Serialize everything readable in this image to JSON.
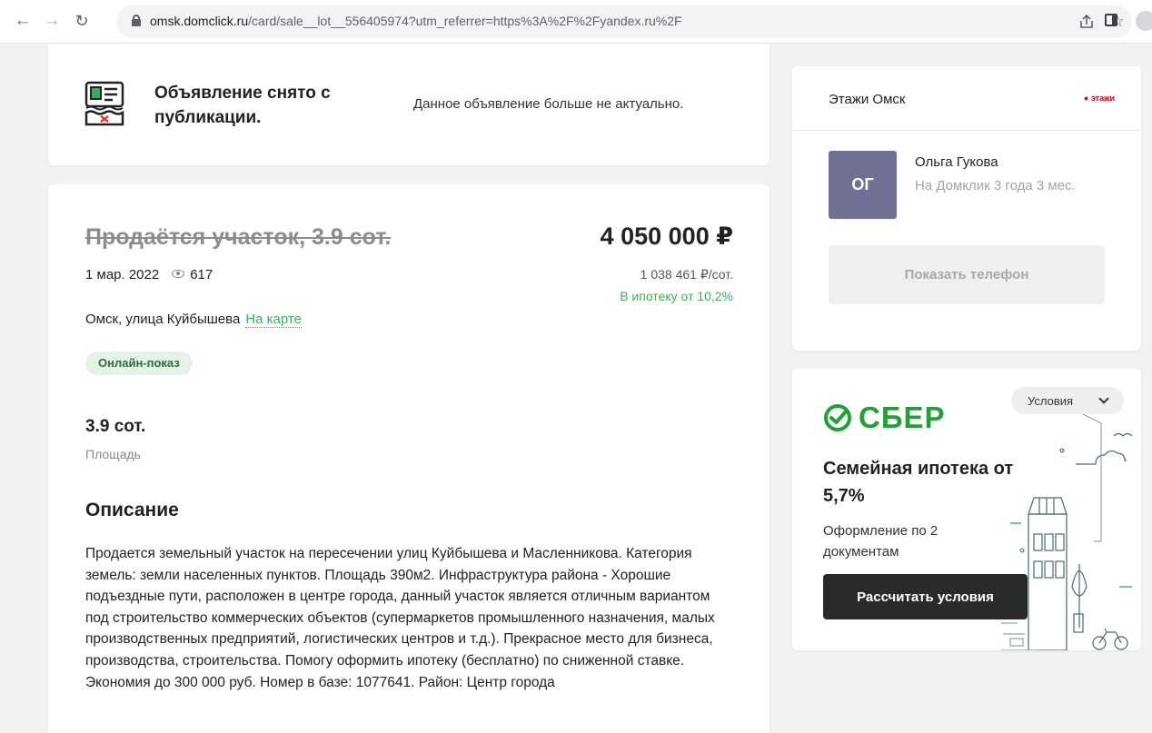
{
  "browser": {
    "url_host": "omsk.domclick.ru",
    "url_rest": "/card/sale__lot__556405974?utm_referrer=https%3A%2F%2Fyandex.ru%2F"
  },
  "notice": {
    "title": "Объявление снято с публикации.",
    "text": "Данное объявление больше не актуально."
  },
  "listing": {
    "title": "Продаётся участок, 3.9 сот.",
    "date": "1 мар. 2022",
    "views": "617",
    "price": "4 050 000 ₽",
    "price_per_unit": "1 038 461 ₽/сот.",
    "mortgage": "В ипотеку от 10,2%",
    "address": "Омск, улица Куйбышева",
    "map_link": "На карте",
    "badge": "Онлайн-показ",
    "area_value": "3.9 сот.",
    "area_label": "Площадь",
    "description_title": "Описание",
    "description": "Продается земельный участок на пересечении улиц Куйбышева и Масленникова. Категория земель: земли населенных пунктов. Площадь 390м2. Инфраструктура района - Хорошие подъездные пути, расположен в центре города, данный участок является отличным вариантом под строительство коммерческих объектов (супермаркетов промышленного назначения, малых производственных предприятий, логистических центров и т.д.). Прекрасное место для бизнеса, производства, строительства. Помогу оформить ипотеку (бесплатно) по сниженной ставке. Экономия до 300 000 руб. Номер в базе: 1077641. Район: Центр города"
  },
  "agency": {
    "name": "Этажи Омск",
    "logo_text": "этажи",
    "agent_initials": "ОГ",
    "agent_name": "Ольга Гукова",
    "agent_since": "На Домклик 3 года 3 мес.",
    "phone_button": "Показать телефон"
  },
  "promo": {
    "brand": "СБЕР",
    "terms_button": "Условия",
    "title": "Семейная ипотека от 5,7%",
    "subtitle": "Оформление по 2 документам",
    "cta": "Рассчитать условия"
  },
  "colors": {
    "accent_green": "#3bb15d",
    "sber_green": "#21a038",
    "avatar_bg": "#6f7094"
  }
}
